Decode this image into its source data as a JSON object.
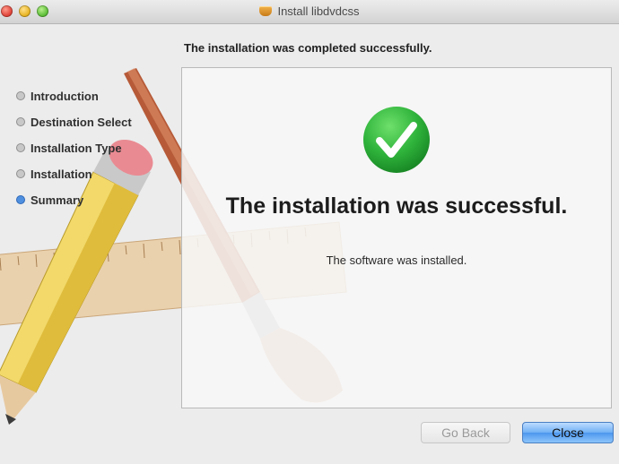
{
  "window": {
    "title": "Install libdvdcss"
  },
  "header": {
    "status": "The installation was completed successfully."
  },
  "sidebar": {
    "steps": [
      {
        "label": "Introduction",
        "current": false
      },
      {
        "label": "Destination Select",
        "current": false
      },
      {
        "label": "Installation Type",
        "current": false
      },
      {
        "label": "Installation",
        "current": false
      },
      {
        "label": "Summary",
        "current": true
      }
    ]
  },
  "main": {
    "icon": "checkmark-icon",
    "title": "The installation was successful.",
    "detail": "The software was installed."
  },
  "buttons": {
    "back": "Go Back",
    "close": "Close"
  },
  "colors": {
    "success_green": "#2fb33b",
    "current_step": "#4f8fe0",
    "default_button": "#6fb0f5"
  }
}
